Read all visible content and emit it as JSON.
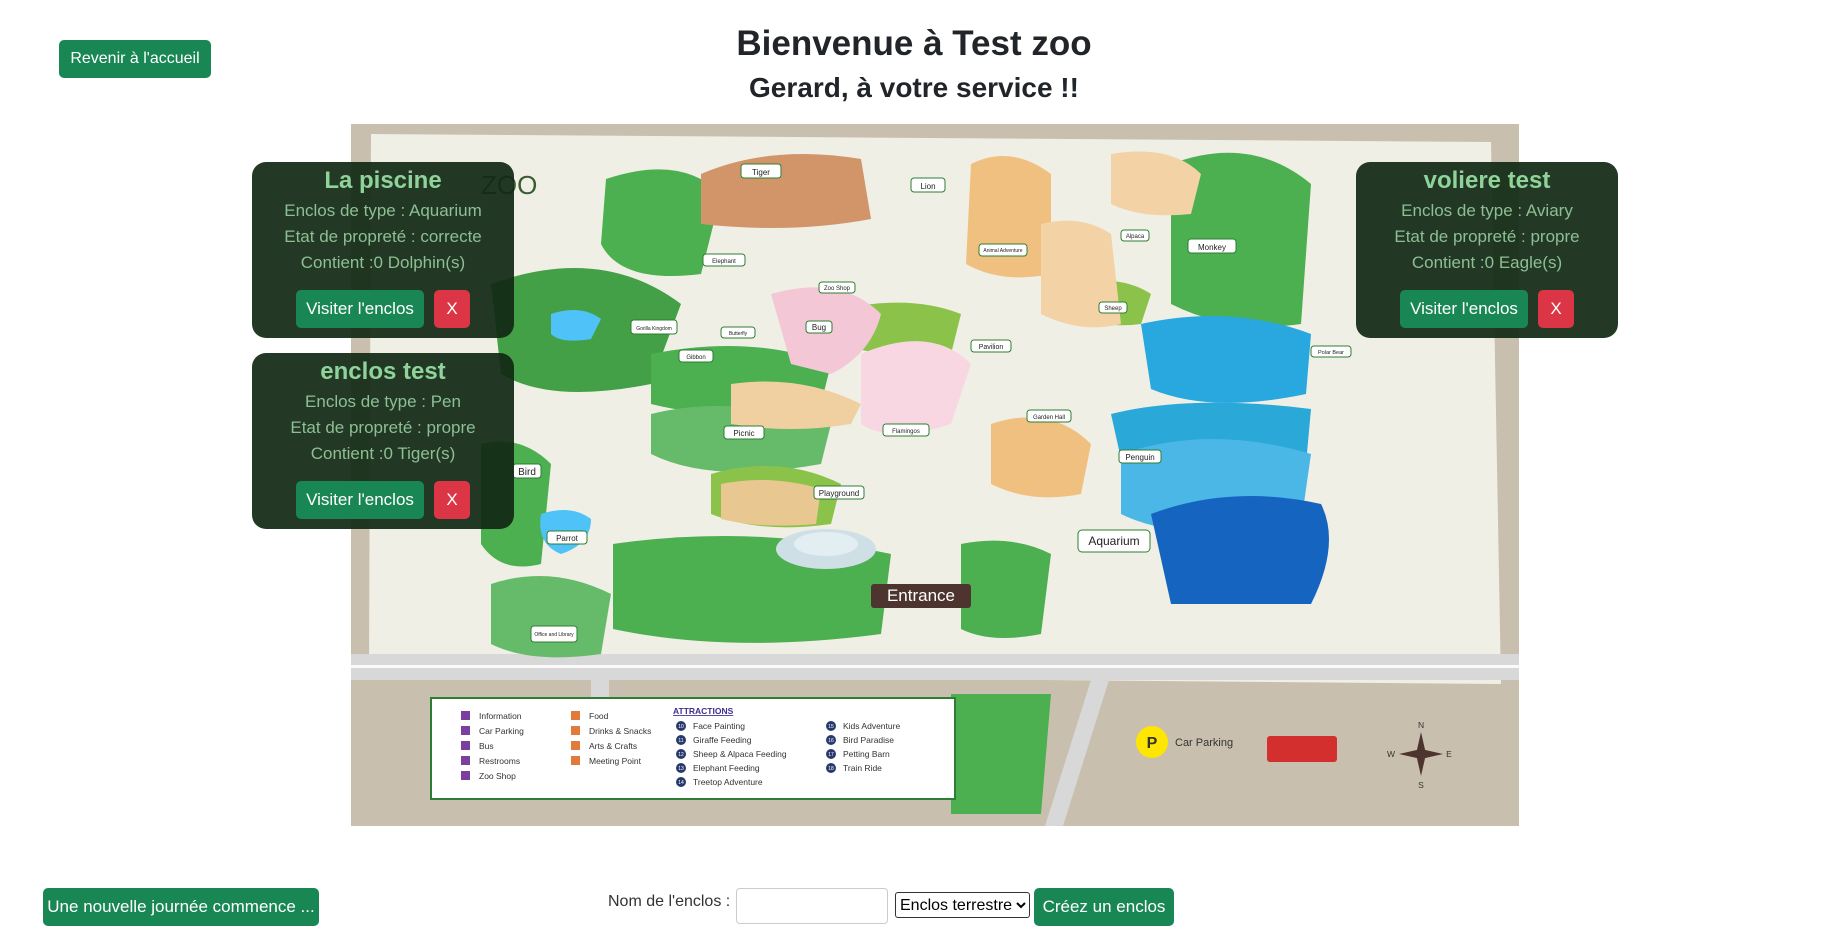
{
  "header": {
    "home_button": "Revenir à l'accueil",
    "title": "Bienvenue à Test zoo",
    "subtitle": "Gerard, à votre service !!"
  },
  "enclosures": [
    {
      "name": "La piscine",
      "type_line": "Enclos de type : Aquarium",
      "clean_line": "Etat de propreté : correcte",
      "contains_line": "Contient :0 Dolphin(s)",
      "visit_label": "Visiter l'enclos",
      "delete_label": "X"
    },
    {
      "name": "enclos test",
      "type_line": "Enclos de type : Pen",
      "clean_line": "Etat de propreté : propre",
      "contains_line": "Contient :0 Tiger(s)",
      "visit_label": "Visiter l'enclos",
      "delete_label": "X"
    },
    {
      "name": "voliere test",
      "type_line": "Enclos de type : Aviary",
      "clean_line": "Etat de propreté : propre",
      "contains_line": "Contient :0 Eagle(s)",
      "visit_label": "Visiter l'enclos",
      "delete_label": "X"
    }
  ],
  "map": {
    "labels": {
      "tiger": "Tiger",
      "lion": "Lion",
      "elephant": "Elephant",
      "monkey": "Monkey",
      "alpaca": "Alpaca",
      "sheep": "Sheep",
      "animal_adventure": "Animal Adventure",
      "zoo_shop": "Zoo Shop",
      "bug": "Bug",
      "butterfly": "Butterfly",
      "gorilla_kingdom": "Gorilla Kingdom",
      "gibbon": "Gibbon",
      "pavilion": "Pavilion",
      "polar_bear": "Polar Bear",
      "flamingos": "Flamingos",
      "garden_hall": "Garden Hall",
      "picnic": "Picnic",
      "playground": "Playground",
      "penguin": "Penguin",
      "bird": "Bird",
      "parrot": "Parrot",
      "aquarium": "Aquarium",
      "entrance": "Entrance",
      "office": "Office and Library",
      "car_parking": "Car Parking",
      "zoo_logo": "ZOO"
    },
    "legend": {
      "col1": [
        "Information",
        "Car Parking",
        "Bus",
        "Restrooms",
        "Zoo Shop"
      ],
      "col2": [
        "Food",
        "Drinks & Snacks",
        "Arts & Crafts",
        "Meeting Point"
      ],
      "attractions_title": "ATTRACTIONS",
      "attractions": [
        {
          "num": "10",
          "label": "Face Painting"
        },
        {
          "num": "11",
          "label": "Giraffe Feeding"
        },
        {
          "num": "12",
          "label": "Sheep & Alpaca Feeding"
        },
        {
          "num": "13",
          "label": "Elephant Feeding"
        },
        {
          "num": "14",
          "label": "Treetop Adventure"
        },
        {
          "num": "15",
          "label": "Kids Adventure"
        },
        {
          "num": "16",
          "label": "Bird Paradise"
        },
        {
          "num": "17",
          "label": "Petting Barn"
        },
        {
          "num": "18",
          "label": "Train Ride"
        }
      ]
    },
    "compass": {
      "n": "N",
      "s": "S",
      "e": "E",
      "w": "W"
    }
  },
  "footer": {
    "new_day_button": "Une nouvelle journée commence ...",
    "name_label": "Nom de l'enclos :",
    "name_value": "",
    "type_selected": "Enclos terrestre",
    "create_button": "Créez un enclos"
  }
}
